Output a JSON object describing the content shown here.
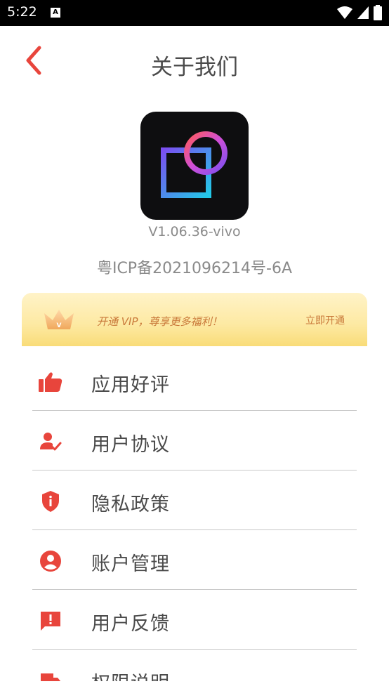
{
  "status_bar": {
    "time": "5:22",
    "notification_label": "A"
  },
  "header": {
    "title": "关于我们",
    "back_icon": "chevron-left-icon"
  },
  "about": {
    "version": "V1.06.36-vivo",
    "icp": "粤ICP备2021096214号-6A"
  },
  "vip": {
    "message": "开通 VIP，尊享更多福利！",
    "action": "立即开通"
  },
  "menu": {
    "items": [
      {
        "label": "应用好评",
        "icon": "thumbs-up-icon"
      },
      {
        "label": "用户协议",
        "icon": "user-check-icon"
      },
      {
        "label": "隐私政策",
        "icon": "shield-icon"
      },
      {
        "label": "账户管理",
        "icon": "account-circle-icon"
      },
      {
        "label": "用户反馈",
        "icon": "feedback-icon"
      },
      {
        "label": "权限说明",
        "icon": "permission-icon"
      }
    ]
  },
  "colors": {
    "accent": "#e8453c",
    "vip_text": "#c9793a"
  }
}
